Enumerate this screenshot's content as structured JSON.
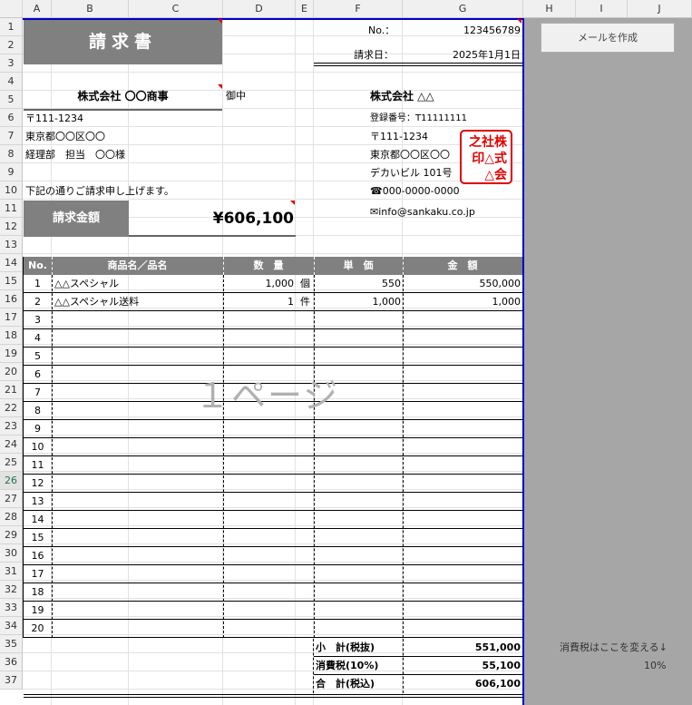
{
  "columns": [
    "A",
    "B",
    "C",
    "D",
    "E",
    "F",
    "G",
    "H",
    "I",
    "J"
  ],
  "rows": [
    "1",
    "2",
    "3",
    "4",
    "5",
    "6",
    "7",
    "8",
    "9",
    "10",
    "11",
    "12",
    "13",
    "14",
    "15",
    "16",
    "17",
    "18",
    "19",
    "20",
    "21",
    "22",
    "23",
    "24",
    "25",
    "26",
    "27",
    "28",
    "29",
    "30",
    "31",
    "32",
    "33",
    "34",
    "35",
    "36",
    "37"
  ],
  "invoice": {
    "title": "請求書",
    "no_label": "No.：",
    "no_value": "123456789",
    "date_label": "請求日：",
    "date_value": "2025年1月1日",
    "client_name": "株式会社 〇〇商事",
    "client_suffix": "御中",
    "client_zip": "〒111-1234",
    "client_address": "東京都〇〇区〇〇",
    "client_contact": "経理部　担当　〇〇様",
    "intro": "下記の通りご請求申し上げます。",
    "amount_label": "請求金額",
    "amount_value": "¥606,100",
    "seller_name": "株式会社 △△",
    "seller_reg": "登録番号：T11111111",
    "seller_zip": "〒111-1234",
    "seller_address": "東京都〇〇区〇〇",
    "seller_building": "デカいビル 101号",
    "seller_tel": "☎000-0000-0000",
    "seller_email": "✉info@sankaku.co.jp",
    "stamp_lines": [
      "之社株",
      "印△式",
      "△会"
    ],
    "headers": {
      "no": "No.",
      "name": "商品名／品名",
      "qty": "数　量",
      "price": "単　価",
      "amount": "金　額"
    },
    "items": [
      {
        "no": "1",
        "name": "△△スペシャル",
        "qty": "1,000",
        "unit": "個",
        "price": "550",
        "amount": "550,000"
      },
      {
        "no": "2",
        "name": "△△スペシャル送料",
        "qty": "1",
        "unit": "件",
        "price": "1,000",
        "amount": "1,000"
      },
      {
        "no": "3"
      },
      {
        "no": "4"
      },
      {
        "no": "5"
      },
      {
        "no": "6"
      },
      {
        "no": "7"
      },
      {
        "no": "8"
      },
      {
        "no": "9"
      },
      {
        "no": "10"
      },
      {
        "no": "11"
      },
      {
        "no": "12"
      },
      {
        "no": "13"
      },
      {
        "no": "14"
      },
      {
        "no": "15"
      },
      {
        "no": "16"
      },
      {
        "no": "17"
      },
      {
        "no": "18"
      },
      {
        "no": "19"
      },
      {
        "no": "20"
      }
    ],
    "subtotal_label": "小　計(税抜)",
    "subtotal_value": "551,000",
    "tax_label": "消費税(10%)",
    "tax_value": "55,100",
    "total_label": "合　計(税込)",
    "total_value": "606,100",
    "watermark": "１ページ"
  },
  "side": {
    "button_label": "メールを作成",
    "tax_note": "消費税はここを変える↓",
    "tax_rate": "10%"
  },
  "colors": {
    "header_gray": "#808080",
    "stamp_red": "#e00000",
    "page_border": "#0000cc",
    "side_gray": "#a6a6a6"
  }
}
